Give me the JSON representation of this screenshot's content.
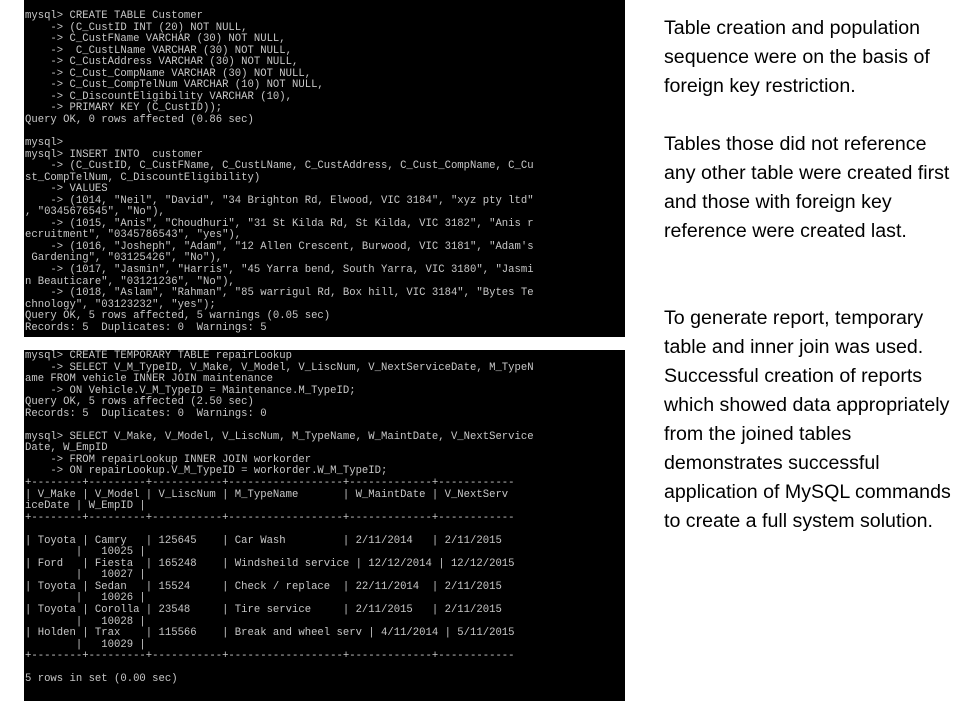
{
  "console_top": {
    "lines": [
      "mysql> CREATE TABLE Customer",
      "    -> (C_CustID INT (20) NOT NULL,",
      "    -> C_CustFName VARCHAR (30) NOT NULL,",
      "    ->  C_CustLName VARCHAR (30) NOT NULL,",
      "    -> C_CustAddress VARCHAR (30) NOT NULL,",
      "    -> C_Cust_CompName VARCHAR (30) NOT NULL,",
      "    -> C_Cust_CompTelNum VARCHAR (10) NOT NULL,",
      "    -> C_DiscountEligibility VARCHAR (10),",
      "    -> PRIMARY KEY (C_CustID));",
      "Query OK, 0 rows affected (0.86 sec)",
      "",
      "mysql>",
      "mysql> INSERT INTO  customer",
      "    -> (C_CustID, C_CustFName, C_CustLName, C_CustAddress, C_Cust_CompName, C_Cu",
      "st_CompTelNum, C_DiscountEligibility)",
      "    -> VALUES",
      "    -> (1014, \"Neil\", \"David\", \"34 Brighton Rd, Elwood, VIC 3184\", \"xyz pty ltd\"",
      ", \"0345676545\", \"No\"),",
      "    -> (1015, \"Anis\", \"Choudhuri\", \"31 St Kilda Rd, St Kilda, VIC 3182\", \"Anis r",
      "ecruitment\", \"0345786543\", \"yes\"),",
      "    -> (1016, \"Josheph\", \"Adam\", \"12 Allen Crescent, Burwood, VIC 3181\", \"Adam's",
      " Gardening\", \"03125426\", \"No\"),",
      "    -> (1017, \"Jasmin\", \"Harris\", \"45 Yarra bend, South Yarra, VIC 3180\", \"Jasmi",
      "n Beauticare\", \"03121236\", \"No\"),",
      "    -> (1018, \"Aslam\", \"Rahman\", \"85 warrigul Rd, Box hill, VIC 3184\", \"Bytes Te",
      "chnology\", \"03123232\", \"yes\");",
      "Query OK, 5 rows affected, 5 warnings (0.05 sec)",
      "Records: 5  Duplicates: 0  Warnings: 5"
    ]
  },
  "console_bottom": {
    "lines": [
      "mysql> CREATE TEMPORARY TABLE repairLookup",
      "    -> SELECT V_M_TypeID, V_Make, V_Model, V_LiscNum, V_NextServiceDate, M_TypeN",
      "ame FROM vehicle INNER JOIN maintenance",
      "    -> ON Vehicle.V_M_TypeID = Maintenance.M_TypeID;",
      "Query OK, 5 rows affected (2.50 sec)",
      "Records: 5  Duplicates: 0  Warnings: 0",
      "",
      "mysql> SELECT V_Make, V_Model, V_LiscNum, M_TypeName, W_MaintDate, V_NextService",
      "Date, W_EmpID",
      "    -> FROM repairLookup INNER JOIN workorder",
      "    -> ON repairLookup.V_M_TypeID = workorder.W_M_TypeID;",
      "+--------+---------+-----------+------------------+-------------+------------",
      "| V_Make | V_Model | V_LiscNum | M_TypeName       | W_MaintDate | V_NextServ",
      "iceDate | W_EmpID |",
      "+--------+---------+-----------+------------------+-------------+------------",
      "",
      "| Toyota | Camry   | 125645    | Car Wash         | 2/11/2014   | 2/11/2015",
      "        |   10025 |",
      "| Ford   | Fiesta  | 165248    | Windsheild service | 12/12/2014 | 12/12/2015",
      "        |   10027 |",
      "| Toyota | Sedan   | 15524     | Check / replace  | 22/11/2014  | 2/11/2015",
      "        |   10026 |",
      "| Toyota | Corolla | 23548     | Tire service     | 2/11/2015   | 2/11/2015",
      "        |   10028 |",
      "| Holden | Trax    | 115566    | Break and wheel serv | 4/11/2014 | 5/11/2015",
      "        |   10029 |",
      "+--------+---------+-----------+------------------+-------------+------------",
      "",
      "5 rows in set (0.00 sec)"
    ]
  },
  "notes": {
    "paragraph_1": "Table creation and population sequence were on the basis of foreign key restriction.",
    "paragraph_2": "Tables those did not reference any other table were created first and those with foreign key reference were created last.",
    "paragraph_3": "To generate report, temporary table and inner join was used.  Successful creation of reports which showed data appropriately from the joined tables demonstrates successful application of MySQL commands to create a full system solution."
  }
}
